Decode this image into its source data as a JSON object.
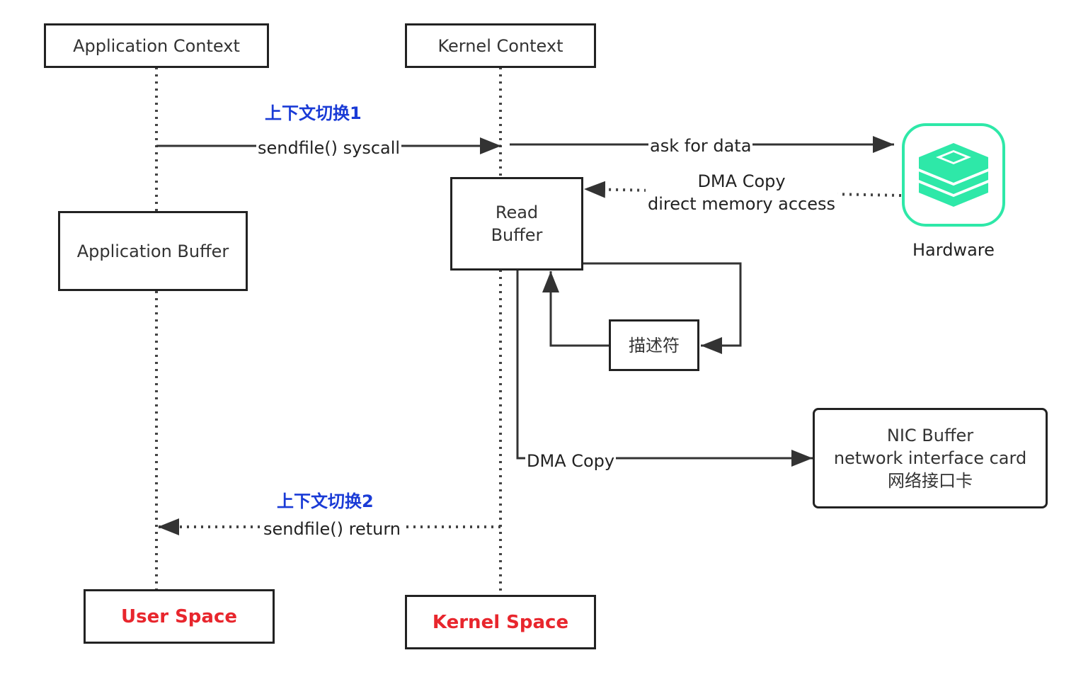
{
  "boxes": {
    "app_context": "Application Context",
    "kernel_context": "Kernel Context",
    "app_buffer": "Application Buffer",
    "read_buffer": "Read\nBuffer",
    "descriptor": "描述符",
    "nic_buffer": "NIC Buffer\nnetwork interface card\n网络接口卡",
    "user_space": "User Space",
    "kernel_space": "Kernel Space"
  },
  "labels": {
    "switch1": "上下文切换1",
    "switch2": "上下文切换2",
    "sendfile_syscall": "sendfile() syscall",
    "sendfile_return": "sendfile() return",
    "ask_for_data": "ask for data",
    "dma_copy_top": "DMA Copy\ndirect memory access",
    "dma_copy_bottom": "DMA Copy",
    "hardware": "Hardware"
  },
  "colors": {
    "accent_blue": "#1a3bd6",
    "accent_red": "#e8262d",
    "hardware_green": "#2ee8a8",
    "line": "#333333"
  }
}
